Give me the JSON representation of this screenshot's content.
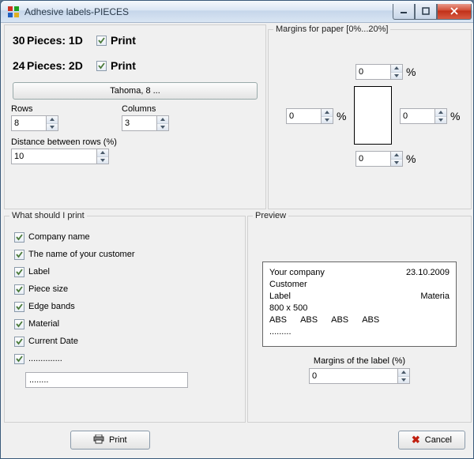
{
  "window": {
    "title": "Adhesive labels-PIECES"
  },
  "pieces": {
    "v1d": "30",
    "lbl1d": "Pieces: 1D",
    "print_lbl": "Print",
    "v2d": "24",
    "lbl2d": "Pieces: 2D"
  },
  "font_btn": "Tahoma, 8 ...",
  "layout": {
    "rows_lbl": "Rows",
    "rows_val": "8",
    "cols_lbl": "Columns",
    "cols_val": "3",
    "dist_lbl": "Distance between rows (%)",
    "dist_val": "10"
  },
  "margins_paper": {
    "legend": "Margins for paper [0%...20%]",
    "top": "0",
    "left": "0",
    "right": "0",
    "bottom": "0",
    "pct": "%"
  },
  "what": {
    "legend": "What should I print",
    "items": [
      "Company name",
      "The name of your customer",
      "Label",
      "Piece size",
      "Edge bands",
      "Material",
      "Current Date",
      ".............."
    ],
    "dotted_val": "........"
  },
  "preview": {
    "legend": "Preview",
    "company": "Your company",
    "date": "23.10.2009",
    "customer": "Customer",
    "label": "Label",
    "material": "Materia",
    "size": "800 x 500",
    "abs": "ABS",
    "dots": ".........",
    "margins_lbl": "Margins of the label (%)",
    "margins_val": "0"
  },
  "buttons": {
    "print": "Print",
    "cancel": "Cancel"
  }
}
